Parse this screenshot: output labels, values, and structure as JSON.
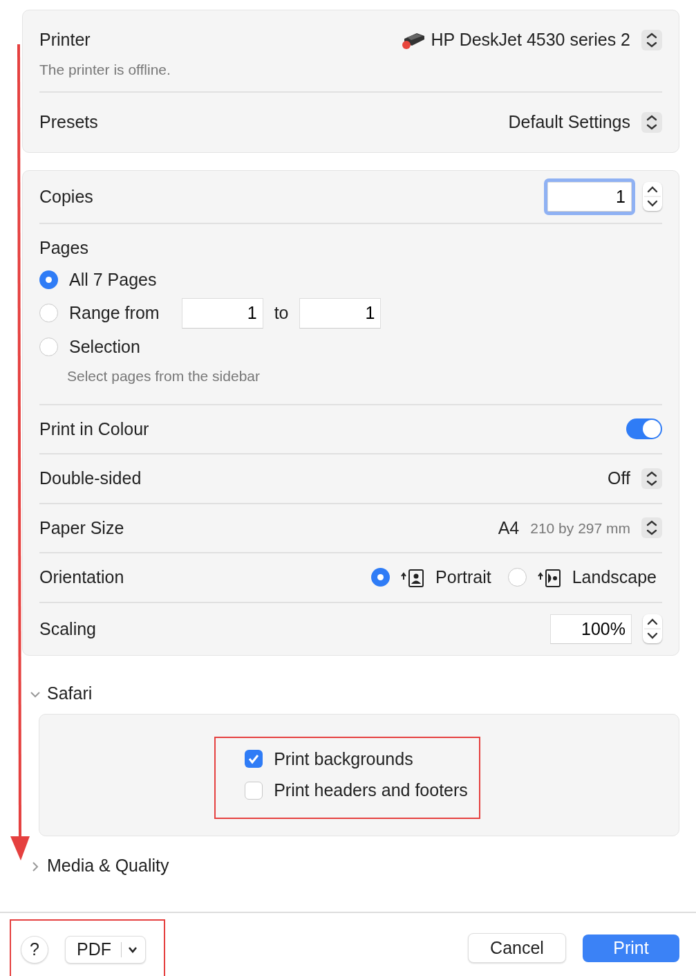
{
  "printer": {
    "label": "Printer",
    "value": "HP DeskJet 4530 series 2",
    "status": "The printer is offline.",
    "offline": true
  },
  "presets": {
    "label": "Presets",
    "value": "Default Settings"
  },
  "copies": {
    "label": "Copies",
    "value": "1",
    "focused": true
  },
  "pages": {
    "label": "Pages",
    "options": [
      {
        "kind": "all",
        "label": "All 7 Pages",
        "selected": true
      },
      {
        "kind": "range",
        "label": "Range from",
        "from": "1",
        "to_label": "to",
        "to": "1",
        "selected": false
      },
      {
        "kind": "selection",
        "label": "Selection",
        "hint": "Select pages from the sidebar",
        "selected": false
      }
    ]
  },
  "settings": [
    {
      "kind": "toggle",
      "label": "Print in Colour",
      "on": true
    },
    {
      "kind": "popup",
      "label": "Double-sided",
      "value": "Off"
    },
    {
      "kind": "popup",
      "label": "Paper Size",
      "value": "A4",
      "detail": "210 by 297 mm"
    },
    {
      "kind": "orientation",
      "label": "Orientation",
      "options": [
        {
          "kind": "portrait",
          "label": "Portrait",
          "selected": true
        },
        {
          "kind": "landscape",
          "label": "Landscape",
          "selected": false
        }
      ]
    },
    {
      "kind": "stepper",
      "label": "Scaling",
      "value": "100%"
    }
  ],
  "safari": {
    "title": "Safari",
    "expanded": true,
    "highlighted": true,
    "checkboxes": [
      {
        "label": "Print backgrounds",
        "checked": true
      },
      {
        "label": "Print headers and footers",
        "checked": false
      }
    ]
  },
  "media_quality": {
    "title": "Media & Quality",
    "expanded": false
  },
  "footer": {
    "help": "?",
    "pdf": "PDF",
    "cancel": "Cancel",
    "print": "Print",
    "highlighted": true
  },
  "scroll_arrow": true
}
